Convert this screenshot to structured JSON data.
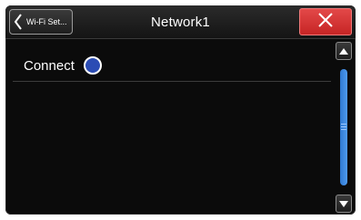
{
  "header": {
    "back_label": "Wi-Fi Set...",
    "title": "Network1",
    "close_icon": "close-icon"
  },
  "content": {
    "items": [
      {
        "label": "Connect",
        "control": "radio",
        "selected": true
      }
    ]
  },
  "scrollbar": {
    "up_icon": "triangle-up-icon",
    "down_icon": "triangle-down-icon",
    "scroll_position_percent": 0
  },
  "colors": {
    "background": "#0b0b0b",
    "close_button": "#d83434",
    "radio_fill": "#2b4cb4",
    "scroll_thumb": "#3a86e0"
  }
}
